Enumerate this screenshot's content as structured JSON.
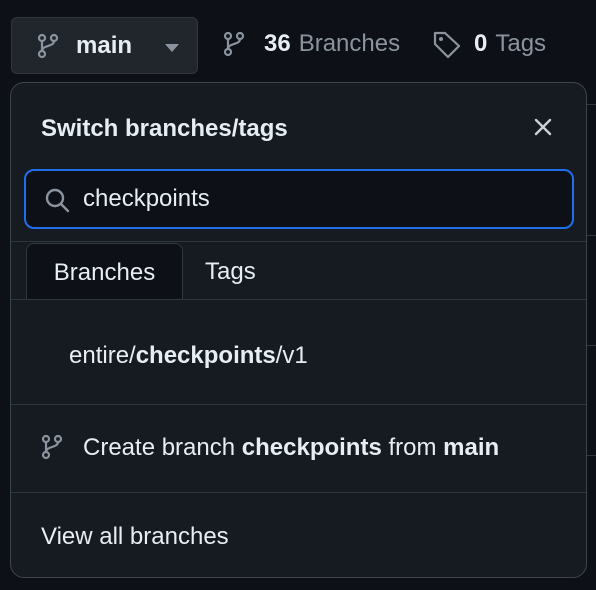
{
  "toolbar": {
    "branch_label": "main",
    "branch_count": "36",
    "branch_word": "Branches",
    "tag_count": "0",
    "tag_word": "Tags"
  },
  "dropdown": {
    "title": "Switch branches/tags",
    "search_value": "checkpoints",
    "tabs": [
      {
        "label": "Branches",
        "active": true
      },
      {
        "label": "Tags",
        "active": false
      }
    ],
    "result": {
      "prefix": "entire/",
      "match": "checkpoints",
      "suffix": "/v1"
    },
    "create": {
      "pre": "Create branch",
      "name": "checkpoints",
      "mid": "from",
      "source": "main"
    },
    "view_all": "View all branches"
  },
  "colors": {
    "accent": "#1f6feb",
    "background": "#0d1117",
    "panel": "#161b22",
    "muted_text": "#8b949e"
  }
}
